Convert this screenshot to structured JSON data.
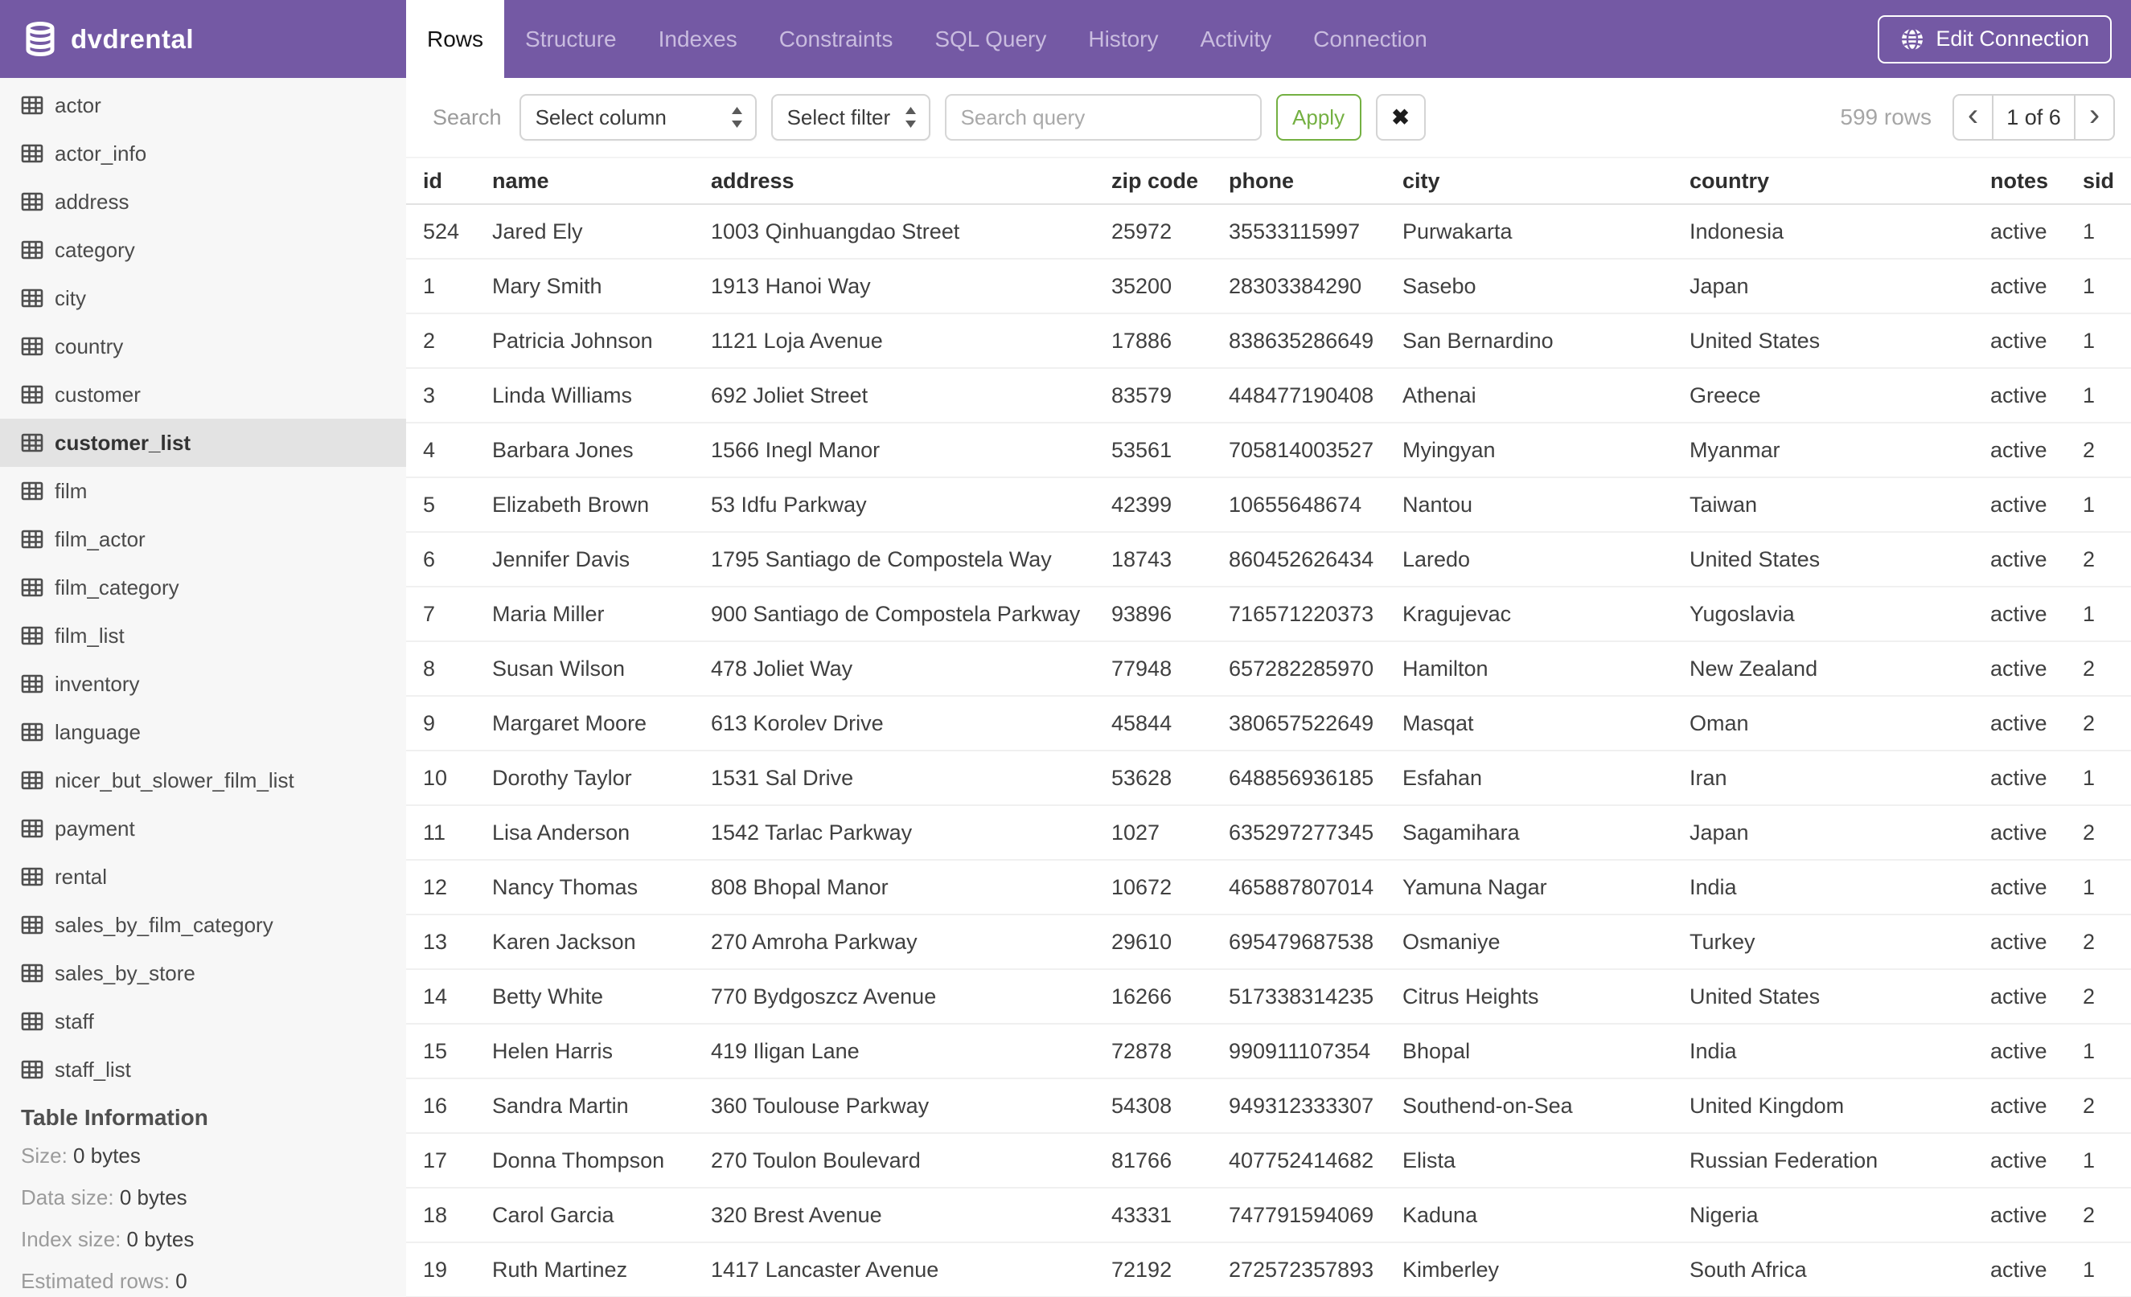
{
  "header": {
    "database_name": "dvdrental",
    "tabs": [
      {
        "label": "Rows",
        "active": true
      },
      {
        "label": "Structure",
        "active": false
      },
      {
        "label": "Indexes",
        "active": false
      },
      {
        "label": "Constraints",
        "active": false
      },
      {
        "label": "SQL Query",
        "active": false
      },
      {
        "label": "History",
        "active": false
      },
      {
        "label": "Activity",
        "active": false
      },
      {
        "label": "Connection",
        "active": false
      }
    ],
    "edit_connection_label": "Edit Connection"
  },
  "toolbar": {
    "search_label": "Search",
    "column_select_value": "Select column",
    "filter_select_value": "Select filter",
    "search_placeholder": "Search query",
    "apply_label": "Apply",
    "clear_icon": "✖",
    "row_count": "599 rows"
  },
  "pagination": {
    "prev_icon": "‹",
    "label": "1 of 6",
    "next_icon": "›"
  },
  "sidebar": {
    "tables": [
      {
        "name": "actor",
        "selected": false
      },
      {
        "name": "actor_info",
        "selected": false
      },
      {
        "name": "address",
        "selected": false
      },
      {
        "name": "category",
        "selected": false
      },
      {
        "name": "city",
        "selected": false
      },
      {
        "name": "country",
        "selected": false
      },
      {
        "name": "customer",
        "selected": false
      },
      {
        "name": "customer_list",
        "selected": true
      },
      {
        "name": "film",
        "selected": false
      },
      {
        "name": "film_actor",
        "selected": false
      },
      {
        "name": "film_category",
        "selected": false
      },
      {
        "name": "film_list",
        "selected": false
      },
      {
        "name": "inventory",
        "selected": false
      },
      {
        "name": "language",
        "selected": false
      },
      {
        "name": "nicer_but_slower_film_list",
        "selected": false
      },
      {
        "name": "payment",
        "selected": false
      },
      {
        "name": "rental",
        "selected": false
      },
      {
        "name": "sales_by_film_category",
        "selected": false
      },
      {
        "name": "sales_by_store",
        "selected": false
      },
      {
        "name": "staff",
        "selected": false
      },
      {
        "name": "staff_list",
        "selected": false
      }
    ],
    "info": {
      "title": "Table Information",
      "items": [
        {
          "label": "Size:",
          "value": "0 bytes"
        },
        {
          "label": "Data size:",
          "value": "0 bytes"
        },
        {
          "label": "Index size:",
          "value": "0 bytes"
        },
        {
          "label": "Estimated rows:",
          "value": "0"
        }
      ]
    }
  },
  "table": {
    "columns": [
      "id",
      "name",
      "address",
      "zip code",
      "phone",
      "city",
      "country",
      "notes",
      "sid"
    ],
    "rows": [
      [
        "524",
        "Jared Ely",
        "1003 Qinhuangdao Street",
        "25972",
        "35533115997",
        "Purwakarta",
        "Indonesia",
        "active",
        "1"
      ],
      [
        "1",
        "Mary Smith",
        "1913 Hanoi Way",
        "35200",
        "28303384290",
        "Sasebo",
        "Japan",
        "active",
        "1"
      ],
      [
        "2",
        "Patricia Johnson",
        "1121 Loja Avenue",
        "17886",
        "838635286649",
        "San Bernardino",
        "United States",
        "active",
        "1"
      ],
      [
        "3",
        "Linda Williams",
        "692 Joliet Street",
        "83579",
        "448477190408",
        "Athenai",
        "Greece",
        "active",
        "1"
      ],
      [
        "4",
        "Barbara Jones",
        "1566 Inegl Manor",
        "53561",
        "705814003527",
        "Myingyan",
        "Myanmar",
        "active",
        "2"
      ],
      [
        "5",
        "Elizabeth Brown",
        "53 Idfu Parkway",
        "42399",
        "10655648674",
        "Nantou",
        "Taiwan",
        "active",
        "1"
      ],
      [
        "6",
        "Jennifer Davis",
        "1795 Santiago de Compostela Way",
        "18743",
        "860452626434",
        "Laredo",
        "United States",
        "active",
        "2"
      ],
      [
        "7",
        "Maria Miller",
        "900 Santiago de Compostela Parkway",
        "93896",
        "716571220373",
        "Kragujevac",
        "Yugoslavia",
        "active",
        "1"
      ],
      [
        "8",
        "Susan Wilson",
        "478 Joliet Way",
        "77948",
        "657282285970",
        "Hamilton",
        "New Zealand",
        "active",
        "2"
      ],
      [
        "9",
        "Margaret Moore",
        "613 Korolev Drive",
        "45844",
        "380657522649",
        "Masqat",
        "Oman",
        "active",
        "2"
      ],
      [
        "10",
        "Dorothy Taylor",
        "1531 Sal Drive",
        "53628",
        "648856936185",
        "Esfahan",
        "Iran",
        "active",
        "1"
      ],
      [
        "11",
        "Lisa Anderson",
        "1542 Tarlac Parkway",
        "1027",
        "635297277345",
        "Sagamihara",
        "Japan",
        "active",
        "2"
      ],
      [
        "12",
        "Nancy Thomas",
        "808 Bhopal Manor",
        "10672",
        "465887807014",
        "Yamuna Nagar",
        "India",
        "active",
        "1"
      ],
      [
        "13",
        "Karen Jackson",
        "270 Amroha Parkway",
        "29610",
        "695479687538",
        "Osmaniye",
        "Turkey",
        "active",
        "2"
      ],
      [
        "14",
        "Betty White",
        "770 Bydgoszcz Avenue",
        "16266",
        "517338314235",
        "Citrus Heights",
        "United States",
        "active",
        "2"
      ],
      [
        "15",
        "Helen Harris",
        "419 Iligan Lane",
        "72878",
        "990911107354",
        "Bhopal",
        "India",
        "active",
        "1"
      ],
      [
        "16",
        "Sandra Martin",
        "360 Toulouse Parkway",
        "54308",
        "949312333307",
        "Southend-on-Sea",
        "United Kingdom",
        "active",
        "2"
      ],
      [
        "17",
        "Donna Thompson",
        "270 Toulon Boulevard",
        "81766",
        "407752414682",
        "Elista",
        "Russian Federation",
        "active",
        "1"
      ],
      [
        "18",
        "Carol Garcia",
        "320 Brest Avenue",
        "43331",
        "747791594069",
        "Kaduna",
        "Nigeria",
        "active",
        "2"
      ],
      [
        "19",
        "Ruth Martinez",
        "1417 Lancaster Avenue",
        "72192",
        "272572357893",
        "Kimberley",
        "South Africa",
        "active",
        "1"
      ]
    ]
  },
  "colors": {
    "accent_purple": "#7459a4",
    "apply_green": "#74b042",
    "sidebar_selected": "#e3e3e3"
  }
}
